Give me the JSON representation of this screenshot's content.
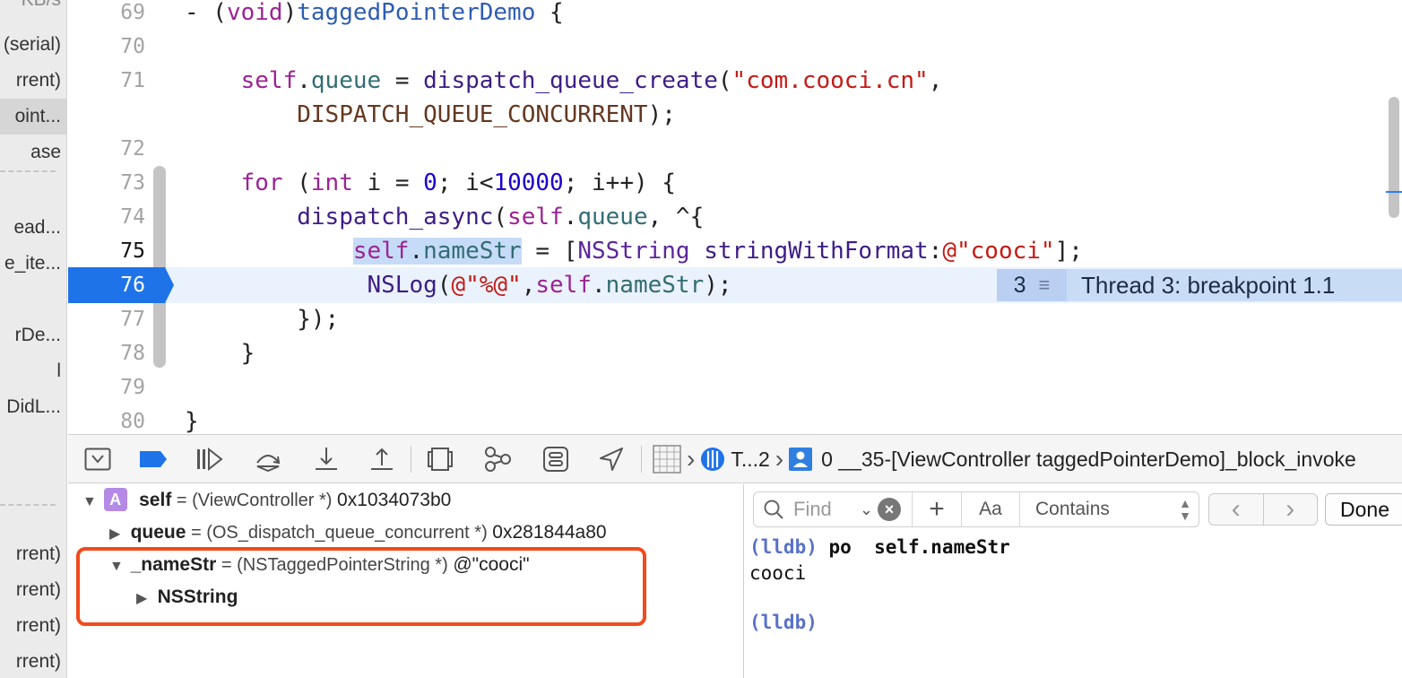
{
  "navigator": {
    "items": [
      {
        "text": "KB/s",
        "selected": false,
        "dim": true
      },
      {
        "text": "(serial)",
        "selected": false,
        "dim": false
      },
      {
        "text": "rrent)",
        "selected": false,
        "dim": false
      },
      {
        "text": "oint...",
        "selected": true,
        "dim": false
      },
      {
        "text": "ase",
        "selected": false,
        "dim": false
      },
      {
        "text": "",
        "selected": false,
        "dim": false
      },
      {
        "text": "ead...",
        "selected": false,
        "dim": false
      },
      {
        "text": "e_ite...",
        "selected": false,
        "dim": false
      },
      {
        "text": "",
        "selected": false,
        "dim": false
      },
      {
        "text": "rDe...",
        "selected": false,
        "dim": false
      },
      {
        "text": "l",
        "selected": false,
        "dim": false
      },
      {
        "text": "DidL...",
        "selected": false,
        "dim": false
      },
      {
        "text": "",
        "selected": false,
        "dim": false
      },
      {
        "text": "",
        "selected": false,
        "dim": false
      },
      {
        "text": "",
        "selected": false,
        "dim": false
      },
      {
        "text": "rrent)",
        "selected": false,
        "dim": false
      },
      {
        "text": "rrent)",
        "selected": false,
        "dim": false
      },
      {
        "text": "rrent)",
        "selected": false,
        "dim": false
      },
      {
        "text": "rrent)",
        "selected": false,
        "dim": false
      }
    ]
  },
  "editor": {
    "line_numbers": [
      {
        "n": "69",
        "current": false
      },
      {
        "n": "70",
        "current": false
      },
      {
        "n": "71",
        "current": false
      },
      {
        "n": "",
        "current": false
      },
      {
        "n": "72",
        "current": false
      },
      {
        "n": "73",
        "current": false
      },
      {
        "n": "74",
        "current": false
      },
      {
        "n": "75",
        "current": true
      },
      {
        "n": "76",
        "current": true
      },
      {
        "n": "77",
        "current": false
      },
      {
        "n": "78",
        "current": false
      },
      {
        "n": "79",
        "current": false
      },
      {
        "n": "80",
        "current": false
      }
    ],
    "breakpoint_line": "76",
    "code_lines": [
      [
        {
          "t": "- (",
          "c": "plain"
        },
        {
          "t": "void",
          "c": "kw"
        },
        {
          "t": ")",
          "c": "plain"
        },
        {
          "t": "taggedPointerDemo",
          "c": "def"
        },
        {
          "t": " {",
          "c": "plain"
        }
      ],
      [],
      [
        {
          "t": "    ",
          "c": "plain"
        },
        {
          "t": "self",
          "c": "kw"
        },
        {
          "t": ".",
          "c": "plain"
        },
        {
          "t": "queue",
          "c": "prop"
        },
        {
          "t": " = ",
          "c": "plain"
        },
        {
          "t": "dispatch_queue_create",
          "c": "fn"
        },
        {
          "t": "(",
          "c": "plain"
        },
        {
          "t": "\"com.cooci.cn\"",
          "c": "str"
        },
        {
          "t": ",",
          "c": "plain"
        }
      ],
      [
        {
          "t": "        ",
          "c": "plain"
        },
        {
          "t": "DISPATCH_QUEUE_CONCURRENT",
          "c": "macro"
        },
        {
          "t": ");",
          "c": "plain"
        }
      ],
      [],
      [
        {
          "t": "    ",
          "c": "plain"
        },
        {
          "t": "for",
          "c": "kw"
        },
        {
          "t": " (",
          "c": "plain"
        },
        {
          "t": "int",
          "c": "kw"
        },
        {
          "t": " i = ",
          "c": "plain"
        },
        {
          "t": "0",
          "c": "num"
        },
        {
          "t": "; i<",
          "c": "plain"
        },
        {
          "t": "10000",
          "c": "num"
        },
        {
          "t": "; i++) {",
          "c": "plain"
        }
      ],
      [
        {
          "t": "        ",
          "c": "plain"
        },
        {
          "t": "dispatch_async",
          "c": "fn"
        },
        {
          "t": "(",
          "c": "plain"
        },
        {
          "t": "self",
          "c": "kw"
        },
        {
          "t": ".",
          "c": "plain"
        },
        {
          "t": "queue",
          "c": "prop"
        },
        {
          "t": ", ^{",
          "c": "plain"
        }
      ],
      [
        {
          "t": "            ",
          "c": "plain"
        },
        {
          "t": "self",
          "c": "kw",
          "sel": true
        },
        {
          "t": ".",
          "c": "plain",
          "sel": true
        },
        {
          "t": "nameStr",
          "c": "prop",
          "sel": true
        },
        {
          "t": " = [",
          "c": "plain"
        },
        {
          "t": "NSString",
          "c": "cls"
        },
        {
          "t": " ",
          "c": "plain"
        },
        {
          "t": "stringWithFormat",
          "c": "fn"
        },
        {
          "t": ":",
          "c": "plain"
        },
        {
          "t": "@\"cooci\"",
          "c": "str"
        },
        {
          "t": "];",
          "c": "plain"
        }
      ],
      [
        {
          "t": "             ",
          "c": "plain"
        },
        {
          "t": "NSLog",
          "c": "fn"
        },
        {
          "t": "(",
          "c": "plain"
        },
        {
          "t": "@\"%@\"",
          "c": "str"
        },
        {
          "t": ",",
          "c": "plain"
        },
        {
          "t": "self",
          "c": "kw"
        },
        {
          "t": ".",
          "c": "plain"
        },
        {
          "t": "nameStr",
          "c": "prop"
        },
        {
          "t": ");",
          "c": "plain"
        }
      ],
      [
        {
          "t": "        });",
          "c": "plain"
        }
      ],
      [
        {
          "t": "    }",
          "c": "plain"
        }
      ],
      [],
      [
        {
          "t": "}",
          "c": "plain"
        }
      ]
    ],
    "thread_badge": {
      "count": "3",
      "message": "Thread 3: breakpoint 1.1"
    }
  },
  "debug_bar": {
    "buttons": [
      "hide-debug-area",
      "breakpoints-toggle",
      "continue",
      "step-over",
      "step-into",
      "step-out",
      "debug-view-hierarchy",
      "memory-graph",
      "environment-overrides",
      "simulate-location"
    ],
    "breadcrumb": {
      "thread": "T...2",
      "frame": "0 __35-[ViewController taggedPointerDemo]_block_invoke"
    },
    "colors": {
      "active_blue": "#1f73e8"
    }
  },
  "variables": {
    "self_row": {
      "badge": "A",
      "name": "self",
      "type": "= (ViewController *)",
      "value": "0x1034073b0"
    },
    "queue_row": {
      "name": "queue",
      "type": "= (OS_dispatch_queue_concurrent *)",
      "value": "0x281844a80"
    },
    "namestr_row": {
      "name": "_nameStr",
      "type": "= (NSTaggedPointerString *)",
      "value": "@\"cooci\""
    },
    "nsstring_row": {
      "name": "NSString"
    },
    "highlight_color": "#f24a1d"
  },
  "console": {
    "find_placeholder": "Find",
    "aa_label": "Aa",
    "contains_label": "Contains",
    "done_label": "Done",
    "lines": [
      {
        "prompt": "(lldb)",
        "cmd": " po  self.nameStr"
      },
      {
        "out": "cooci"
      },
      {
        "out": ""
      },
      {
        "prompt": "(lldb)",
        "cmd": ""
      }
    ]
  }
}
